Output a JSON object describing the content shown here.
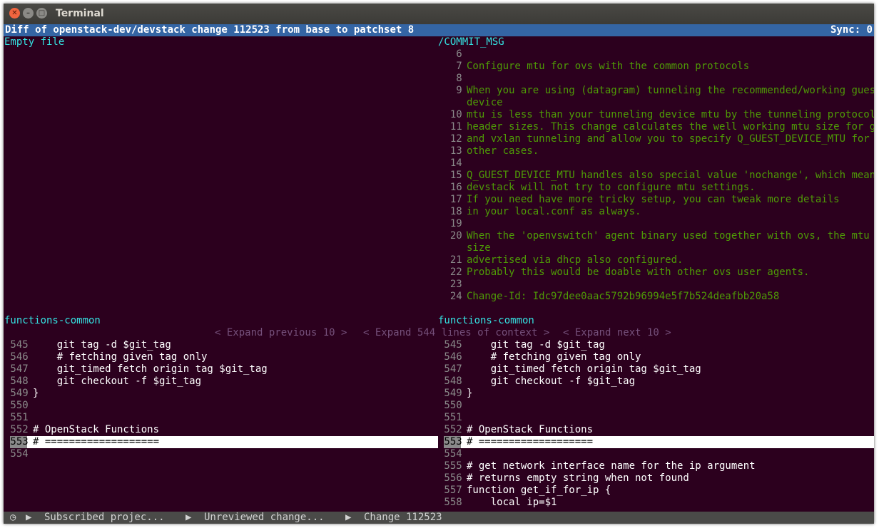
{
  "window": {
    "title": "Terminal"
  },
  "header": {
    "text": "Diff of openstack-dev/devstack change 112523 from base to patchset 8",
    "sync": "Sync: 0"
  },
  "top_left": {
    "label": "Empty file"
  },
  "top_right": {
    "file": "/COMMIT_MSG",
    "lines": [
      {
        "n": "6",
        "t": ""
      },
      {
        "n": "7",
        "t": "Configure mtu for ovs with the common protocols"
      },
      {
        "n": "8",
        "t": ""
      },
      {
        "n": "9",
        "t": "When you are using (datagram) tunneling the recommended/working guest"
      },
      {
        "n": "",
        "t": "device"
      },
      {
        "n": "10",
        "t": "mtu is less than your tunneling device mtu by the tunneling protocols"
      },
      {
        "n": "11",
        "t": "header sizes. This change calculates the well working mtu size for gre"
      },
      {
        "n": "12",
        "t": "and vxlan tunneling and allow you to specify Q_GUEST_DEVICE_MTU for"
      },
      {
        "n": "13",
        "t": "other cases."
      },
      {
        "n": "14",
        "t": ""
      },
      {
        "n": "15",
        "t": "Q_GUEST_DEVICE_MTU handles also special value 'nochange', which means"
      },
      {
        "n": "16",
        "t": "devstack will not try to configure mtu settings."
      },
      {
        "n": "17",
        "t": "If you need have more tricky setup, you can tweak more details"
      },
      {
        "n": "18",
        "t": "in your local.conf as always."
      },
      {
        "n": "19",
        "t": ""
      },
      {
        "n": "20",
        "t": "When the 'openvswitch' agent binary used together with ovs, the mtu"
      },
      {
        "n": "",
        "t": "size"
      },
      {
        "n": "21",
        "t": "advertised via dhcp also configured."
      },
      {
        "n": "22",
        "t": "Probably this would be doable with other ovs user agents."
      },
      {
        "n": "23",
        "t": ""
      },
      {
        "n": "24",
        "t": "Change-Id: Idc97dee0aac5792b96994e5f7b524deafbb20a58"
      }
    ]
  },
  "bottom": {
    "left_file": "functions-common",
    "right_file": "functions-common",
    "expand_prev": "< Expand previous 10 >",
    "expand_ctx": "< Expand 544 lines of context >",
    "expand_next": "< Expand next 10 >",
    "left_lines": [
      {
        "n": "545",
        "t": "    git tag -d $git_tag"
      },
      {
        "n": "546",
        "t": "    # fetching given tag only"
      },
      {
        "n": "547",
        "t": "    git_timed fetch origin tag $git_tag"
      },
      {
        "n": "548",
        "t": "    git checkout -f $git_tag"
      },
      {
        "n": "549",
        "t": "}"
      },
      {
        "n": "550",
        "t": ""
      },
      {
        "n": "551",
        "t": ""
      },
      {
        "n": "552",
        "t": "# OpenStack Functions"
      },
      {
        "n": "553",
        "t": "# ==================="
      },
      {
        "n": "554",
        "t": ""
      }
    ],
    "right_lines": [
      {
        "n": "545",
        "t": "    git tag -d $git_tag"
      },
      {
        "n": "546",
        "t": "    # fetching given tag only"
      },
      {
        "n": "547",
        "t": "    git_timed fetch origin tag $git_tag"
      },
      {
        "n": "548",
        "t": "    git checkout -f $git_tag"
      },
      {
        "n": "549",
        "t": "}"
      },
      {
        "n": "550",
        "t": ""
      },
      {
        "n": "551",
        "t": ""
      },
      {
        "n": "552",
        "t": "# OpenStack Functions"
      },
      {
        "n": "553",
        "t": "# ==================="
      },
      {
        "n": "554",
        "t": ""
      },
      {
        "n": "555",
        "t": "# get network interface name for the ip argument"
      },
      {
        "n": "556",
        "t": "# returns empty string when not found"
      },
      {
        "n": "557",
        "t": "function get_if_for_ip {"
      },
      {
        "n": "558",
        "t": "    local ip=$1"
      }
    ]
  },
  "status": {
    "crumb1": "Subscribed projec...",
    "crumb2": "Unreviewed change...",
    "crumb3": "Change 112523"
  },
  "icons": {
    "clock": "clock-icon",
    "arrow": "triangle-right-icon"
  }
}
